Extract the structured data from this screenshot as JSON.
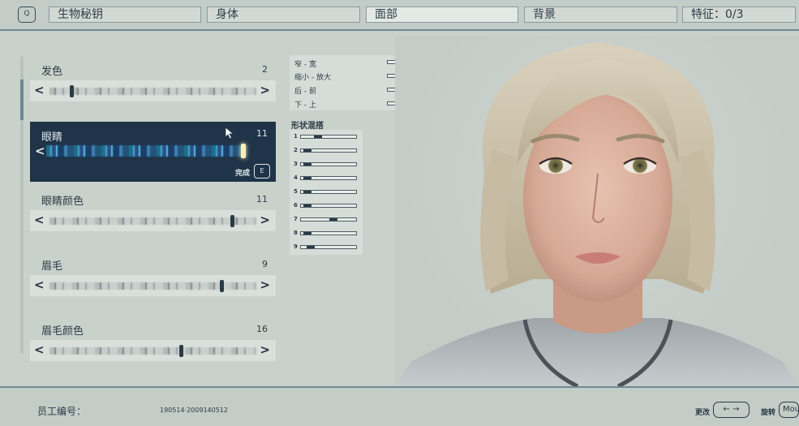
{
  "header": {
    "key_hint": "Q",
    "tabs": [
      {
        "label": "生物秘钥"
      },
      {
        "label": "身体"
      },
      {
        "label": "面部"
      },
      {
        "label": "背景"
      },
      {
        "label": "特征：0/3"
      }
    ],
    "active_tab": "面部"
  },
  "options": [
    {
      "label": "发色",
      "value": "2",
      "position": 0.1
    },
    {
      "label": "眼睛",
      "value": "11",
      "position": 1.0
    },
    {
      "label": "眼睛颜色",
      "value": "11",
      "position": 0.89
    },
    {
      "label": "眉毛",
      "value": "9",
      "position": 0.84
    },
    {
      "label": "眉毛颜色",
      "value": "16",
      "position": 0.64
    }
  ],
  "selected_option": {
    "done_label": "完成",
    "done_key": "E"
  },
  "shape": {
    "rows": [
      {
        "label": "窄 - 宽",
        "level": 0.8
      },
      {
        "label": "缩小 - 放大",
        "level": 0.93
      },
      {
        "label": "后 - 前",
        "level": 0.5
      },
      {
        "label": "下 - 上",
        "level": 0.65
      }
    ]
  },
  "morph": {
    "title": "形状混搭",
    "rows": [
      {
        "num": "1",
        "level": 0.28
      },
      {
        "num": "2",
        "level": 0.05
      },
      {
        "num": "3",
        "level": 0.05
      },
      {
        "num": "4",
        "level": 0.05
      },
      {
        "num": "5",
        "level": 0.05
      },
      {
        "num": "6",
        "level": 0.05
      },
      {
        "num": "7",
        "level": 0.6
      },
      {
        "num": "8",
        "level": 0.05
      },
      {
        "num": "9",
        "level": 0.12
      }
    ]
  },
  "footer": {
    "employee_label": "员工编号：",
    "employee_id": "190514·2009140512",
    "change_label": "更改",
    "change_key": "← →",
    "rotate_label": "旋转",
    "rotate_key": "Mouse"
  },
  "colors": {
    "selected_bg": "#1f3448",
    "accent_border": "#6e8a96"
  }
}
